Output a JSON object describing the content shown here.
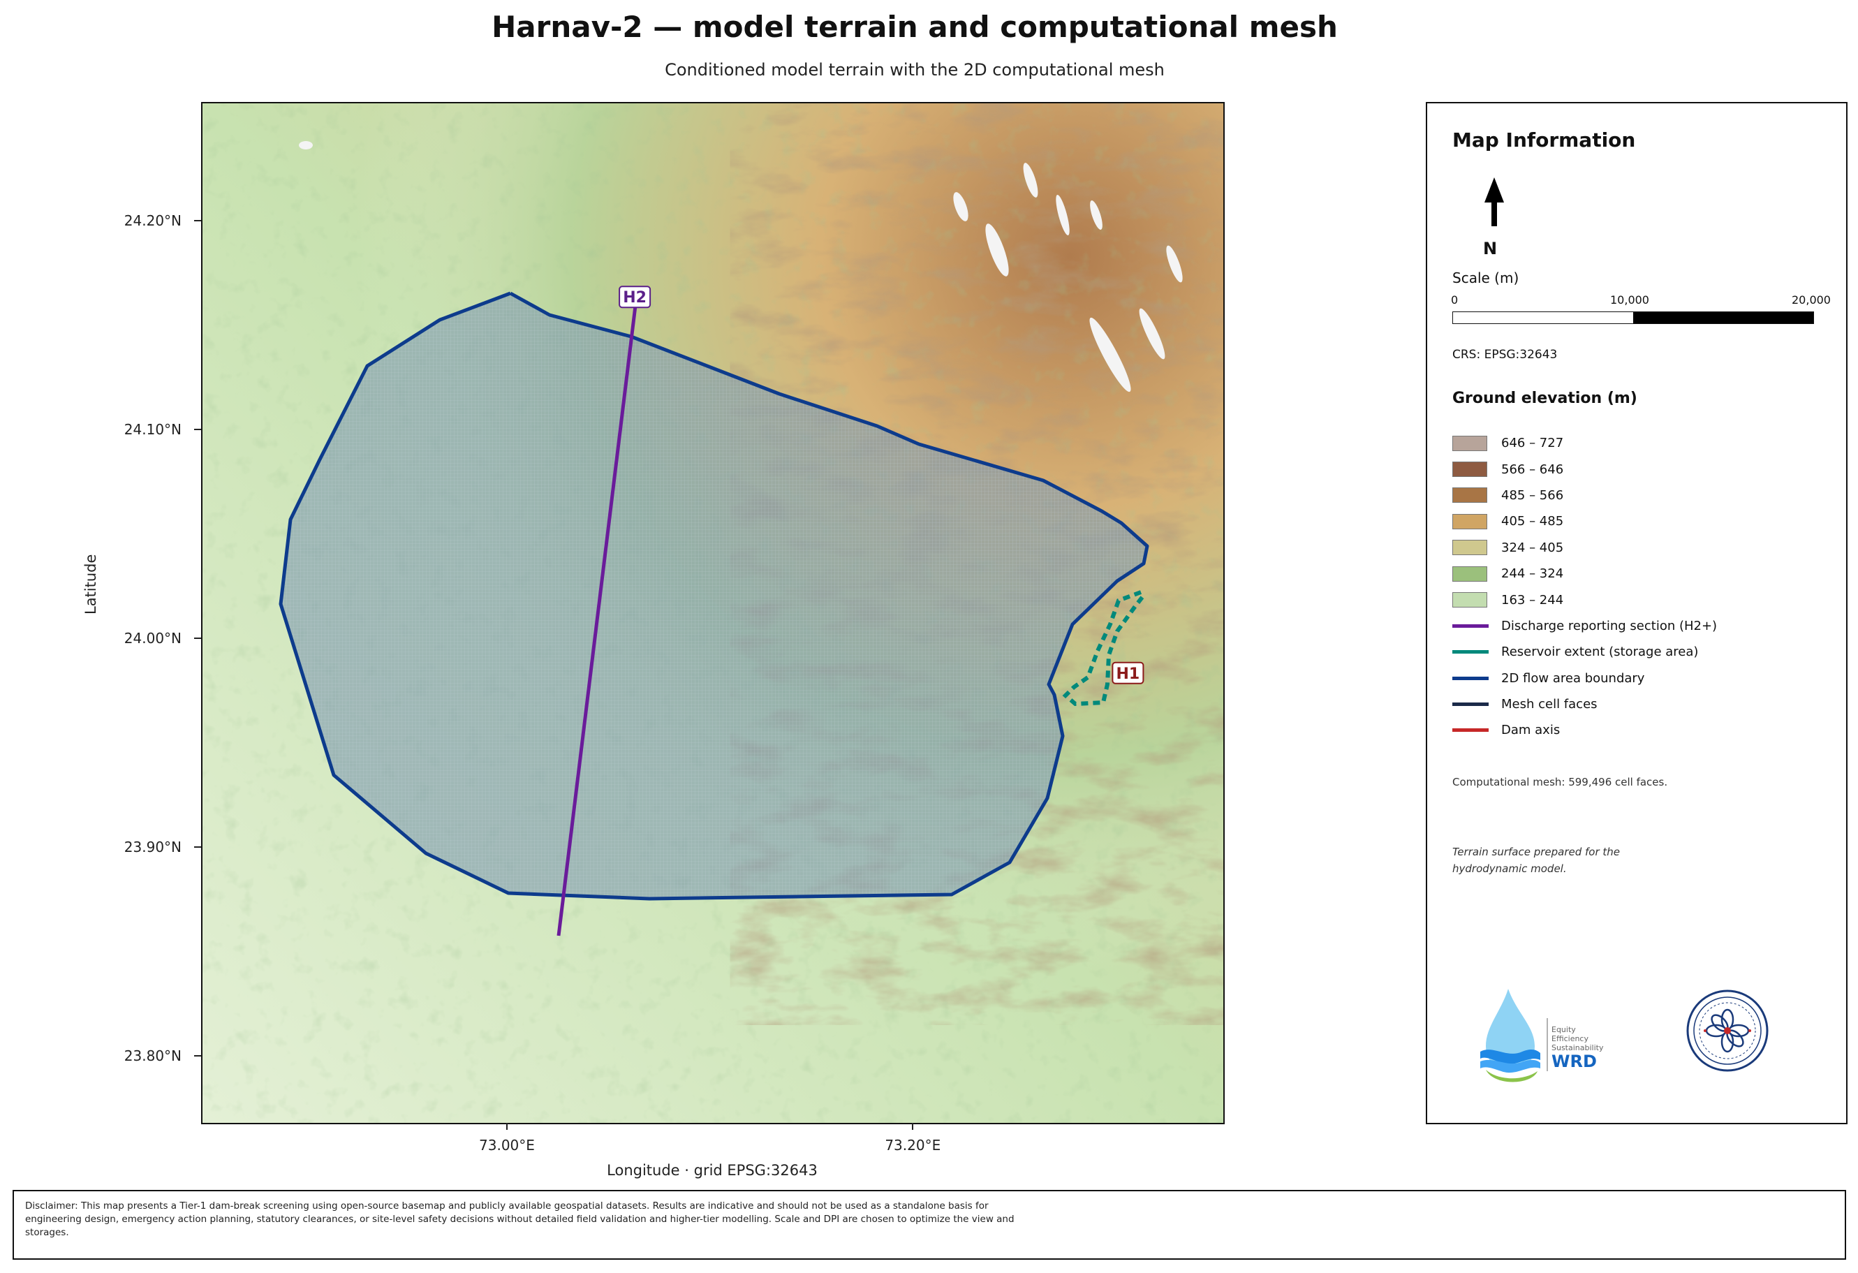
{
  "title": "Harnav-2 — model terrain and computational mesh",
  "subtitle": "Conditioned model terrain with the 2D computational mesh",
  "axes": {
    "ylabel": "Latitude",
    "xlabel": "Longitude   ·   grid EPSG:32643",
    "yticks": [
      "24.20°N",
      "24.10°N",
      "24.00°N",
      "23.90°N",
      "23.80°N"
    ],
    "xticks": [
      "73.00°E",
      "73.20°E"
    ]
  },
  "map": {
    "lon_range": [
      72.85,
      73.353
    ],
    "lat_range": [
      23.768,
      24.256
    ],
    "markers": [
      {
        "id": "h2",
        "label": "H2",
        "color": "#5b1f8a",
        "lon": 73.063,
        "lat": 24.163
      },
      {
        "id": "h1",
        "label": "H1",
        "color": "#8b1a1a",
        "lon": 73.306,
        "lat": 23.983
      }
    ],
    "colors": {
      "flow_boundary": "#0d3b8c",
      "discharge_section": "#6a1b9a",
      "reservoir": "#00897b",
      "mesh_fill": "#7f9bb0"
    }
  },
  "panel": {
    "title": "Map Information",
    "north": "N",
    "scale_title": "Scale (m)",
    "scale_labels": [
      "0",
      "10,000",
      "20,000"
    ],
    "crs": "CRS: EPSG:32643",
    "legend_title": "Ground elevation (m)",
    "elevation_classes": [
      {
        "label": "646 – 727",
        "color": "#b7a49a"
      },
      {
        "label": "566 – 646",
        "color": "#8e5b41"
      },
      {
        "label": "485 – 566",
        "color": "#a87545"
      },
      {
        "label": "405 – 485",
        "color": "#d0a564"
      },
      {
        "label": "324 – 405",
        "color": "#cfc88e"
      },
      {
        "label": "244 – 324",
        "color": "#9bc07c"
      },
      {
        "label": "163 – 244",
        "color": "#c3ddb0"
      }
    ],
    "line_items": [
      {
        "label": "Discharge reporting section (H2+)",
        "color": "#6a1b9a"
      },
      {
        "label": "Reservoir extent (storage area)",
        "color": "#00897b"
      },
      {
        "label": "2D flow area boundary",
        "color": "#0d3b8c"
      },
      {
        "label": "Mesh cell faces",
        "color": "#1b2a49"
      },
      {
        "label": "Dam axis",
        "color": "#c62828"
      }
    ],
    "mesh_note": "Computational mesh: 599,496 cell faces.",
    "terrain_note": "Terrain surface prepared for the hydrodynamic model.",
    "logo_text": [
      "Equity",
      "Efficiency",
      "Sustainability",
      "WRD"
    ]
  },
  "disclaimer": "Disclaimer: This map presents a Tier-1 dam-break screening using open-source basemap and publicly available geospatial datasets. Results are indicative and should not be used as a standalone basis for engineering design, emergency action planning, statutory clearances, or site-level safety decisions without detailed field validation and higher-tier modelling. Scale and DPI are chosen to optimize the view and storages."
}
